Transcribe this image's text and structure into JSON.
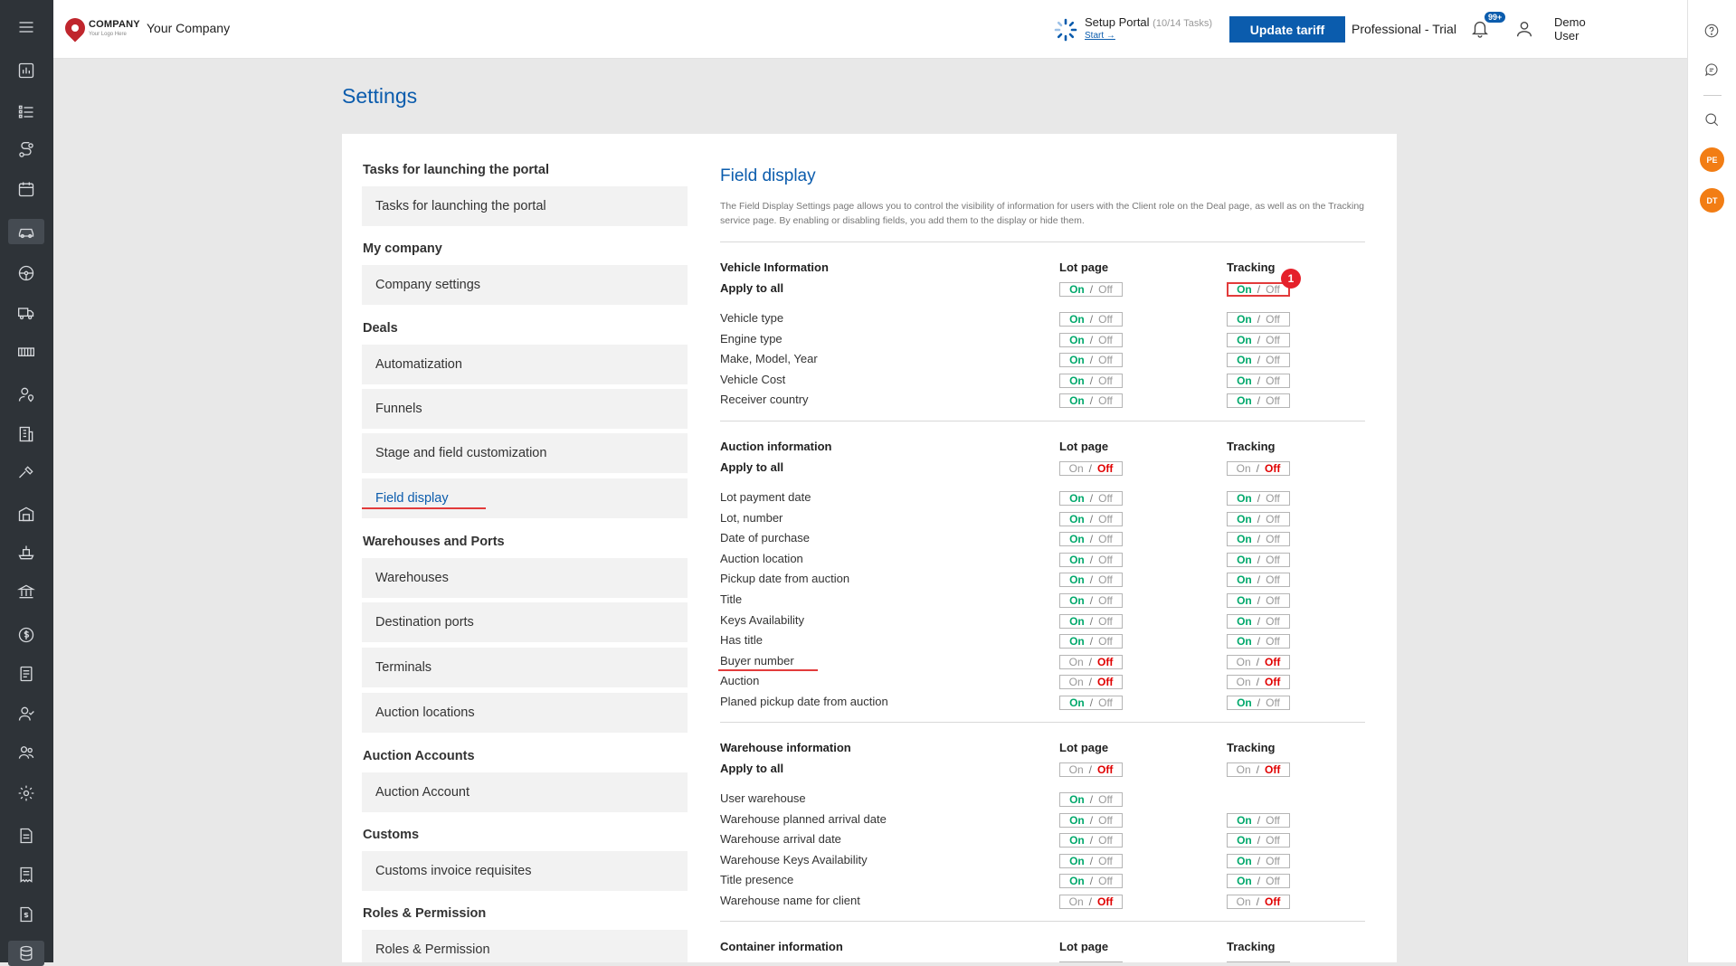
{
  "header": {
    "logo_word": "COMPANY",
    "logo_tagline": "Your Logo Here",
    "company_name": "Your Company",
    "setup_title": "Setup Portal",
    "setup_progress": "(10/14 Tasks)",
    "setup_link": "Start →",
    "update_button": "Update tariff",
    "plan": "Professional - Trial",
    "notif_badge": "99+",
    "user_first": "Demo",
    "user_last": "User"
  },
  "right_rail": {
    "avatar1": "PE",
    "avatar2": "DT"
  },
  "page_title": "Settings",
  "nav": {
    "tasks_header": "Tasks for launching the portal",
    "tasks_item": "Tasks for launching the portal",
    "company_header": "My company",
    "company_item": "Company settings",
    "deals_header": "Deals",
    "deals_items": [
      "Automatization",
      "Funnels",
      "Stage and field customization",
      "Field display"
    ],
    "warehouses_header": "Warehouses and Ports",
    "warehouses_items": [
      "Warehouses",
      "Destination ports",
      "Terminals",
      "Auction locations"
    ],
    "auction_header": "Auction Accounts",
    "auction_item": "Auction Account",
    "customs_header": "Customs",
    "customs_item": "Customs invoice requisites",
    "roles_header": "Roles & Permission",
    "roles_item": "Roles & Permission"
  },
  "field_display": {
    "title": "Field display",
    "description": "The Field Display Settings page allows you to control the visibility of information for users with the Client role on the Deal page, as well as on the Tracking service page. By enabling or disabling fields, you add them to the display or hide them.",
    "toggle_on": "On",
    "toggle_sep": "/",
    "toggle_off": "Off",
    "col_lot": "Lot page",
    "col_tracking": "Tracking",
    "apply_all": "Apply to all",
    "annotation_number": "1",
    "groups": [
      {
        "name": "Vehicle Information",
        "apply_lot": "on",
        "apply_tracking": "on",
        "rows": [
          {
            "label": "Vehicle type",
            "lot": "on",
            "tracking": "on"
          },
          {
            "label": "Engine type",
            "lot": "on",
            "tracking": "on"
          },
          {
            "label": "Make, Model, Year",
            "lot": "on",
            "tracking": "on"
          },
          {
            "label": "Vehicle Cost",
            "lot": "on",
            "tracking": "on"
          },
          {
            "label": "Receiver country",
            "lot": "on",
            "tracking": "on"
          }
        ]
      },
      {
        "name": "Auction information",
        "apply_lot": "off",
        "apply_tracking": "off",
        "rows": [
          {
            "label": "Lot payment date",
            "lot": "on",
            "tracking": "on"
          },
          {
            "label": "Lot, number",
            "lot": "on",
            "tracking": "on"
          },
          {
            "label": "Date of purchase",
            "lot": "on",
            "tracking": "on"
          },
          {
            "label": "Auction location",
            "lot": "on",
            "tracking": "on"
          },
          {
            "label": "Pickup date from auction",
            "lot": "on",
            "tracking": "on"
          },
          {
            "label": "Title",
            "lot": "on",
            "tracking": "on"
          },
          {
            "label": "Keys Availability",
            "lot": "on",
            "tracking": "on"
          },
          {
            "label": "Has title",
            "lot": "on",
            "tracking": "on"
          },
          {
            "label": "Buyer number",
            "lot": "off",
            "tracking": "off"
          },
          {
            "label": "Auction",
            "lot": "off",
            "tracking": "off"
          },
          {
            "label": "Planed pickup date from auction",
            "lot": "on",
            "tracking": "on"
          }
        ]
      },
      {
        "name": "Warehouse information",
        "apply_lot": "off",
        "apply_tracking": "off",
        "rows": [
          {
            "label": "User warehouse",
            "lot": "on",
            "tracking": "none"
          },
          {
            "label": "Warehouse planned arrival date",
            "lot": "on",
            "tracking": "on"
          },
          {
            "label": "Warehouse arrival date",
            "lot": "on",
            "tracking": "on"
          },
          {
            "label": "Warehouse Keys Availability",
            "lot": "on",
            "tracking": "on"
          },
          {
            "label": "Title presence",
            "lot": "on",
            "tracking": "on"
          },
          {
            "label": "Warehouse name for client",
            "lot": "off",
            "tracking": "off"
          }
        ]
      },
      {
        "name": "Container information",
        "apply_lot": "off",
        "apply_tracking": "off",
        "rows": []
      }
    ]
  }
}
